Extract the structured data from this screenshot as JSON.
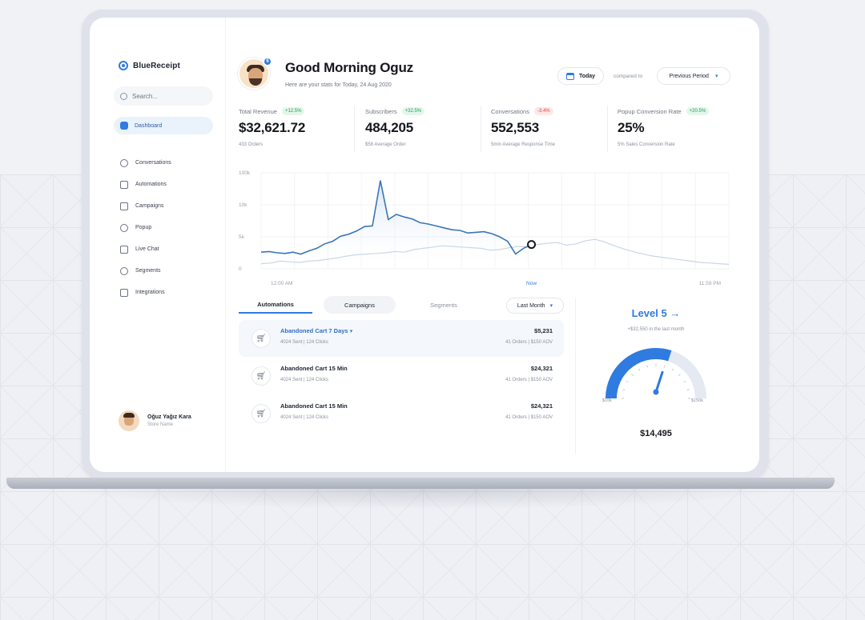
{
  "brand": {
    "name": "BlueReceipt",
    "accent": "#2f7be0"
  },
  "sidebar": {
    "search_placeholder": "Search...",
    "active_item": {
      "label": "Dashboard",
      "icon": "home-icon"
    },
    "items": [
      {
        "label": "Conversations",
        "icon": "chat-icon"
      },
      {
        "label": "Automations",
        "icon": "automation-icon"
      },
      {
        "label": "Campaigns",
        "icon": "campaign-icon"
      },
      {
        "label": "Popup",
        "icon": "popup-icon"
      },
      {
        "label": "Live Chat",
        "icon": "live-chat-icon"
      },
      {
        "label": "Segments",
        "icon": "segments-icon"
      },
      {
        "label": "Integrations",
        "icon": "integrations-icon"
      }
    ],
    "profile": {
      "name": "Oğuz Yağız Kara",
      "subtitle": "Store Name"
    }
  },
  "header": {
    "greeting": "Good Morning Oguz",
    "subtitle": "Here are your stats for Today, 24 Aug 2020",
    "avatar_badge": "6",
    "date_button": "Today",
    "compared_to": "compared to",
    "period_select": "Previous Period"
  },
  "stats": [
    {
      "label": "Total Revenue",
      "change": "+12.5%",
      "direction": "up",
      "value": "$32,621.72",
      "sub": "433 Orders"
    },
    {
      "label": "Subscribers",
      "change": "+32.5%",
      "direction": "up",
      "value": "484,205",
      "sub": "$58 Average Order"
    },
    {
      "label": "Conversations",
      "change": "-3.4%",
      "direction": "down",
      "value": "552,553",
      "sub": "5min Average Response Time"
    },
    {
      "label": "Popup Conversion Rate",
      "change": "+20.5%",
      "direction": "up",
      "value": "25%",
      "sub": "5% Sales Conversion Rate"
    }
  ],
  "chart_data": {
    "type": "line",
    "y_ticks": [
      "100k",
      "10k",
      "5k",
      "0"
    ],
    "x_ticks": [
      "12:00 AM",
      "Now",
      "11:59 PM"
    ],
    "ylim": [
      0,
      15
    ],
    "series": [
      {
        "role": "current",
        "values": [
          2.6,
          2.7,
          2.5,
          2.4,
          2.6,
          2.3,
          2.8,
          3.2,
          3.9,
          4.3,
          5.1,
          5.4,
          5.9,
          6.6,
          6.7,
          13.8,
          7.7,
          8.5,
          8.1,
          7.8,
          7.2,
          7.0,
          6.7,
          6.4,
          6.1,
          6.0,
          5.6,
          5.7,
          5.8,
          5.5,
          5.0,
          4.3,
          2.3,
          3.2,
          3.8
        ],
        "color": "#3a76b8"
      },
      {
        "role": "previous",
        "values": [
          0.8,
          0.9,
          1.2,
          1.1,
          1.0,
          1.2,
          1.3,
          1.5,
          1.7,
          2.0,
          2.2,
          2.3,
          2.4,
          2.5,
          2.7,
          2.6,
          3.0,
          3.2,
          3.4,
          3.6,
          3.5,
          3.4,
          3.3,
          3.2,
          2.9,
          3.0,
          3.3,
          3.5,
          3.4,
          3.8,
          4.0,
          4.1,
          3.7,
          3.9,
          4.4,
          4.6,
          4.2,
          3.6,
          3.1,
          2.7,
          2.3,
          2.0,
          1.8,
          1.6,
          1.4,
          1.2,
          1.0,
          0.9,
          0.8,
          0.7
        ],
        "color": "#c9d6e6"
      }
    ],
    "grid": true
  },
  "tabs": [
    {
      "label": "Automations",
      "state": "active"
    },
    {
      "label": "Campaigns",
      "state": "hover"
    },
    {
      "label": "Segments",
      "state": "inactive"
    }
  ],
  "range_select": "Last Month",
  "automations": [
    {
      "title": "Abandoned Cart 7 Days",
      "meta": "4024 Sent | 124 Clicks",
      "amount": "$5,231",
      "amount_sub": "41 Orders | $150 AOV",
      "highlighted": true
    },
    {
      "title": "Abandoned Cart 15 Min",
      "meta": "4024 Sent | 124 Clicks",
      "amount": "$24,321",
      "amount_sub": "41 Orders | $150 AOV",
      "highlighted": false
    },
    {
      "title": "Abandoned Cart 15 Min",
      "meta": "4024 Sent | 124 Clicks",
      "amount": "$24,321",
      "amount_sub": "41 Orders | $150 AOV",
      "highlighted": false
    }
  ],
  "level": {
    "title": "Level 5",
    "subtitle": "+$32,550 in the last month",
    "min_label": "$10k",
    "max_label": "$150k",
    "value": "$14,495",
    "fill_fraction": 0.6
  }
}
